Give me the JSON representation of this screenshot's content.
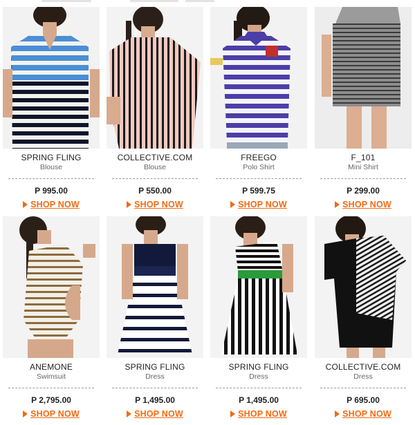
{
  "products": [
    {
      "brand": "SPRING FLING",
      "category": "Blouse",
      "price": "P 995.00",
      "cta": "SHOP NOW",
      "image": "model-blue-navy-striped-blouse"
    },
    {
      "brand": "COLLECTIVE.COM",
      "category": "Blouse",
      "price": "P 550.00",
      "cta": "SHOP NOW",
      "image": "model-pink-black-striped-blouse"
    },
    {
      "brand": "FREEGO",
      "category": "Polo Shirt",
      "price": "P 599.75",
      "cta": "SHOP NOW",
      "image": "model-purple-striped-polo"
    },
    {
      "brand": "F_101",
      "category": "Mini Shirt",
      "price": "P 299.00",
      "cta": "SHOP NOW",
      "image": "model-grey-striped-mini-skirt"
    },
    {
      "brand": "ANEMONE",
      "category": "Swimsuit",
      "price": "P 2,795.00",
      "cta": "SHOP NOW",
      "image": "model-brown-striped-swimsuit"
    },
    {
      "brand": "SPRING FLING",
      "category": "Dress",
      "price": "P 1,495.00",
      "cta": "SHOP NOW",
      "image": "model-navy-white-striped-dress"
    },
    {
      "brand": "SPRING FLING",
      "category": "Dress",
      "price": "P 1,495.00",
      "cta": "SHOP NOW",
      "image": "model-black-white-striped-green-belt-dress"
    },
    {
      "brand": "COLLECTIVE.COM",
      "category": "Dress",
      "price": "P 695.00",
      "cta": "SHOP NOW",
      "image": "model-black-striped-asymmetric-dress"
    }
  ],
  "colors": {
    "accent": "#f26a10",
    "text": "#222222",
    "subtext": "#666666"
  }
}
